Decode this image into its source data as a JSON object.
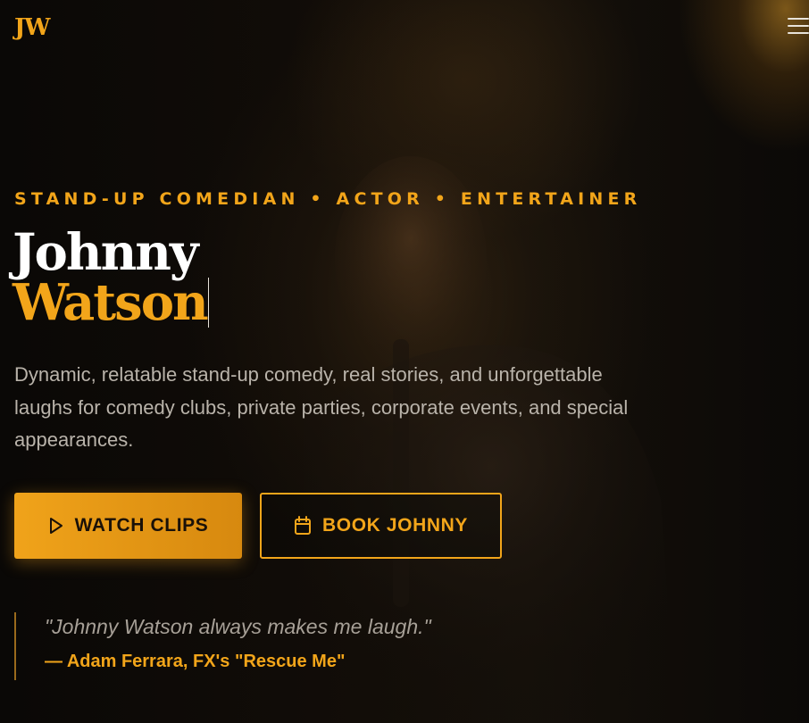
{
  "header": {
    "logo_text": "JW",
    "menu_icon": "hamburger-menu-icon"
  },
  "hero": {
    "tagline": "STAND-UP COMEDIAN • ACTOR • ENTERTAINER",
    "first_name": "Johnny",
    "last_name": "Watson",
    "description": "Dynamic, relatable stand-up comedy, real stories, and unforgettable laughs for comedy clubs, private parties, corporate events, and special appearances.",
    "buttons": {
      "watch_label": "WATCH CLIPS",
      "watch_icon": "play-icon",
      "book_label": "BOOK JOHNNY",
      "book_icon": "calendar-icon"
    }
  },
  "testimonial": {
    "quote": "\"Johnny Watson always makes me laugh.\"",
    "author": "— Adam Ferrara, FX's \"Rescue Me\""
  },
  "colors": {
    "accent": "#f2a51a",
    "background": "#0b0907",
    "text_primary": "#ffffff",
    "text_muted": "#b9b3aa"
  }
}
